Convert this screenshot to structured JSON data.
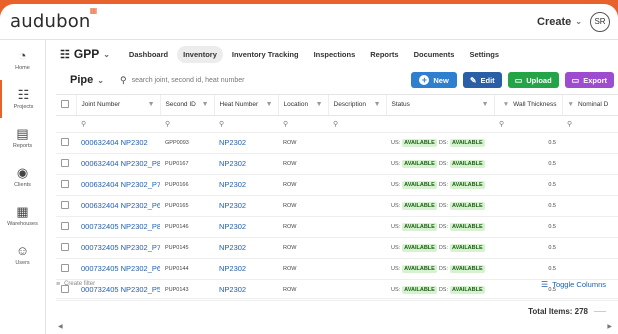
{
  "app": {
    "logo_text": "audubon",
    "create_label": "Create",
    "avatar_initials": "SR"
  },
  "sidebar": {
    "items": [
      {
        "label": "Home",
        "icon": "speedometer-icon"
      },
      {
        "label": "Projects",
        "icon": "projects-tree-icon"
      },
      {
        "label": "Reports",
        "icon": "clipboard-icon"
      },
      {
        "label": "Clients",
        "icon": "globe-icon"
      },
      {
        "label": "Warehouses",
        "icon": "building-icon"
      },
      {
        "label": "Users",
        "icon": "users-icon"
      }
    ]
  },
  "nav": {
    "project": "GPP",
    "tabs": [
      "Dashboard",
      "Inventory",
      "Inventory Tracking",
      "Inspections",
      "Reports",
      "Documents",
      "Settings"
    ],
    "active_tab": "Inventory"
  },
  "toolbar": {
    "asset_type": "Pipe",
    "search_placeholder": "search joint, second id, heat number",
    "new_label": "New",
    "edit_label": "Edit",
    "upload_label": "Upload",
    "export_label": "Export"
  },
  "table": {
    "columns": [
      "Joint Number",
      "Second ID",
      "Heat Number",
      "Location",
      "Description",
      "Status",
      "Wall Thickness",
      "Nominal D"
    ],
    "status_prefix_us": "US:",
    "status_prefix_ds": "DS:",
    "rows": [
      {
        "joint": "000632404 NP2302",
        "second_id": "GPP0093",
        "heat": "NP2302",
        "location": "ROW",
        "us": "AVAILABLE",
        "ds": "AVAILABLE",
        "wall": "0.5"
      },
      {
        "joint": "000632404 NP2302_P8",
        "second_id": "PUP0167",
        "heat": "NP2302",
        "location": "ROW",
        "us": "AVAILABLE",
        "ds": "AVAILABLE",
        "wall": "0.5"
      },
      {
        "joint": "000632404 NP2302_P7",
        "second_id": "PUP0166",
        "heat": "NP2302",
        "location": "ROW",
        "us": "AVAILABLE",
        "ds": "AVAILABLE",
        "wall": "0.5"
      },
      {
        "joint": "000632404 NP2302_P6",
        "second_id": "PUP0165",
        "heat": "NP2302",
        "location": "ROW",
        "us": "AVAILABLE",
        "ds": "AVAILABLE",
        "wall": "0.5"
      },
      {
        "joint": "000732405 NP2302_P8",
        "second_id": "PUP0146",
        "heat": "NP2302",
        "location": "ROW",
        "us": "AVAILABLE",
        "ds": "AVAILABLE",
        "wall": "0.5"
      },
      {
        "joint": "000732405 NP2302_P7",
        "second_id": "PUP0145",
        "heat": "NP2302",
        "location": "ROW",
        "us": "AVAILABLE",
        "ds": "AVAILABLE",
        "wall": "0.5"
      },
      {
        "joint": "000732405 NP2302_P6",
        "second_id": "PUP0144",
        "heat": "NP2302",
        "location": "ROW",
        "us": "AVAILABLE",
        "ds": "AVAILABLE",
        "wall": "0.5"
      },
      {
        "joint": "000732405 NP2302_P5",
        "second_id": "PUP0143",
        "heat": "NP2302",
        "location": "ROW",
        "us": "AVAILABLE",
        "ds": "AVAILABLE",
        "wall": "0.5"
      }
    ]
  },
  "footer": {
    "create_filter": "Create filter",
    "toggle_columns": "Toggle Columns",
    "total_items": "Total Items: 278"
  },
  "colors": {
    "brand": "#e8622c",
    "link": "#1f5fae",
    "available_bg": "#d7f2d0"
  }
}
